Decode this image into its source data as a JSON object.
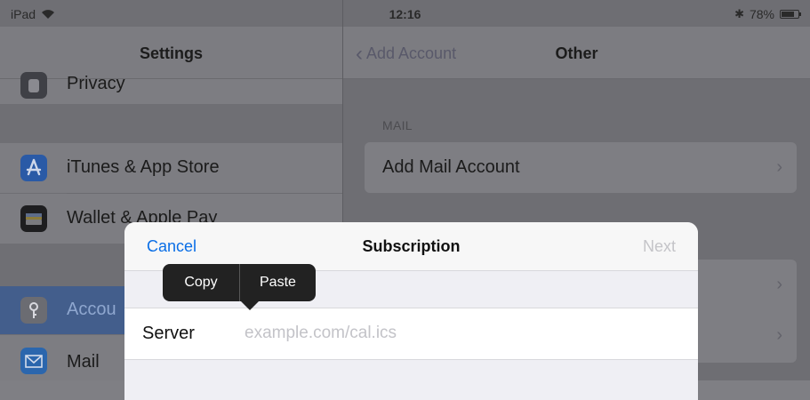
{
  "status_bar": {
    "device": "iPad",
    "time": "12:16",
    "battery": "78%",
    "battery_level": 0.78
  },
  "settings_pane": {
    "title": "Settings",
    "items": [
      {
        "label": "Privacy",
        "icon": "hand-icon"
      },
      {
        "label": "iTunes & App Store",
        "icon": "app-store-icon"
      },
      {
        "label": "Wallet & Apple Pay",
        "icon": "wallet-icon"
      },
      {
        "label": "Accou",
        "icon": "key-icon"
      },
      {
        "label": "Mail",
        "icon": "mail-icon"
      }
    ]
  },
  "other_pane": {
    "back_label": "Add Account",
    "title": "Other",
    "mail_section_header": "MAIL",
    "add_mail_label": "Add Mail Account"
  },
  "modal": {
    "cancel_label": "Cancel",
    "title": "Subscription",
    "next_label": "Next",
    "server_label": "Server",
    "server_value": "",
    "server_placeholder": "example.com/cal.ics"
  },
  "edit_menu": {
    "copy_label": "Copy",
    "paste_label": "Paste"
  },
  "colors": {
    "accent": "#0a6ee6",
    "dim_overlay": "#7f7f84"
  }
}
